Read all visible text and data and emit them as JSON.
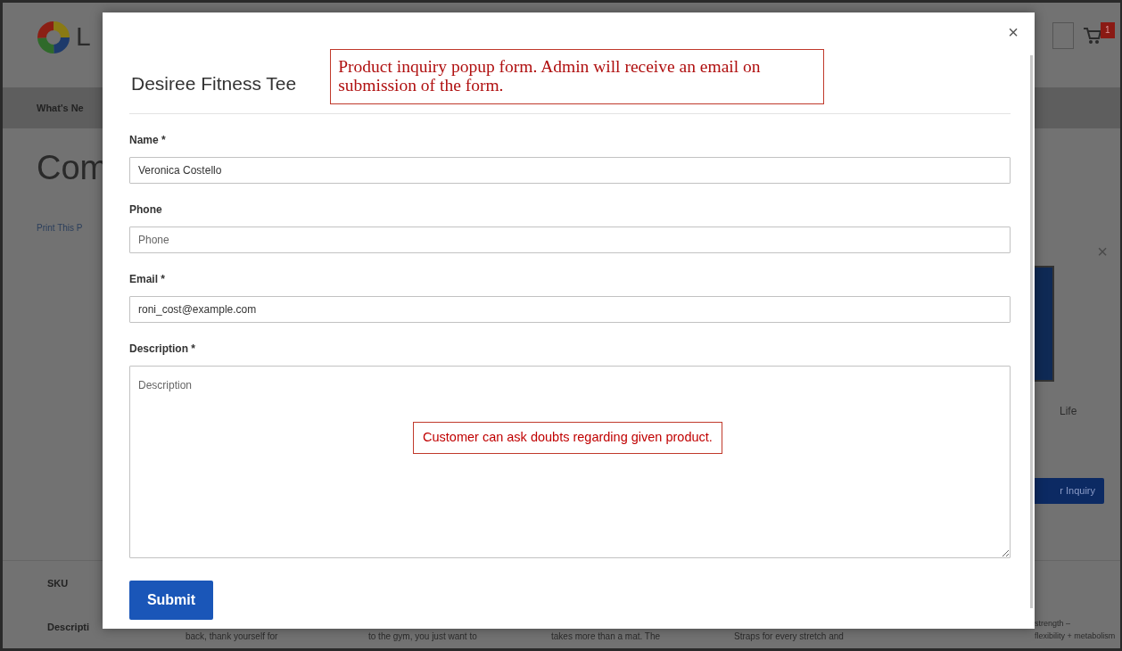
{
  "background_page": {
    "logo_text": "L",
    "cart_count": "1",
    "nav_item": "What's Ne",
    "page_title": "Com",
    "print_link": "Print This P",
    "close_mark": "×",
    "product_name": "Life",
    "inquiry_button": "r Inquiry",
    "sku_label": "SKU",
    "description_label": "Descripti",
    "description_columns": [
      {
        "lines": [
          "back, thank yourself for"
        ]
      },
      {
        "lines": [
          "to the gym, you just want to"
        ]
      },
      {
        "lines": [
          "takes more than a mat. The"
        ]
      },
      {
        "lines": [
          "Straps for every stretch and"
        ]
      },
      {
        "lines": [
          "strength –",
          "flexibility + metabolism"
        ]
      }
    ]
  },
  "modal": {
    "close": "×",
    "title": "Desiree Fitness Tee",
    "fields": [
      {
        "kind": "input",
        "label": "Name *",
        "value": "Veronica Costello"
      },
      {
        "kind": "input",
        "label": "Phone",
        "placeholder": "Phone"
      },
      {
        "kind": "input",
        "label": "Email *",
        "value": "roni_cost@example.com"
      },
      {
        "kind": "textarea",
        "label": "Description *",
        "placeholder": "Description"
      }
    ],
    "submit": "Submit"
  },
  "annotations": [
    {
      "kind": "header-note",
      "text": "Product inquiry popup form. Admin will receive an email on submission of the form."
    },
    {
      "kind": "field-note",
      "text": "Customer can ask doubts regarding given product."
    }
  ]
}
